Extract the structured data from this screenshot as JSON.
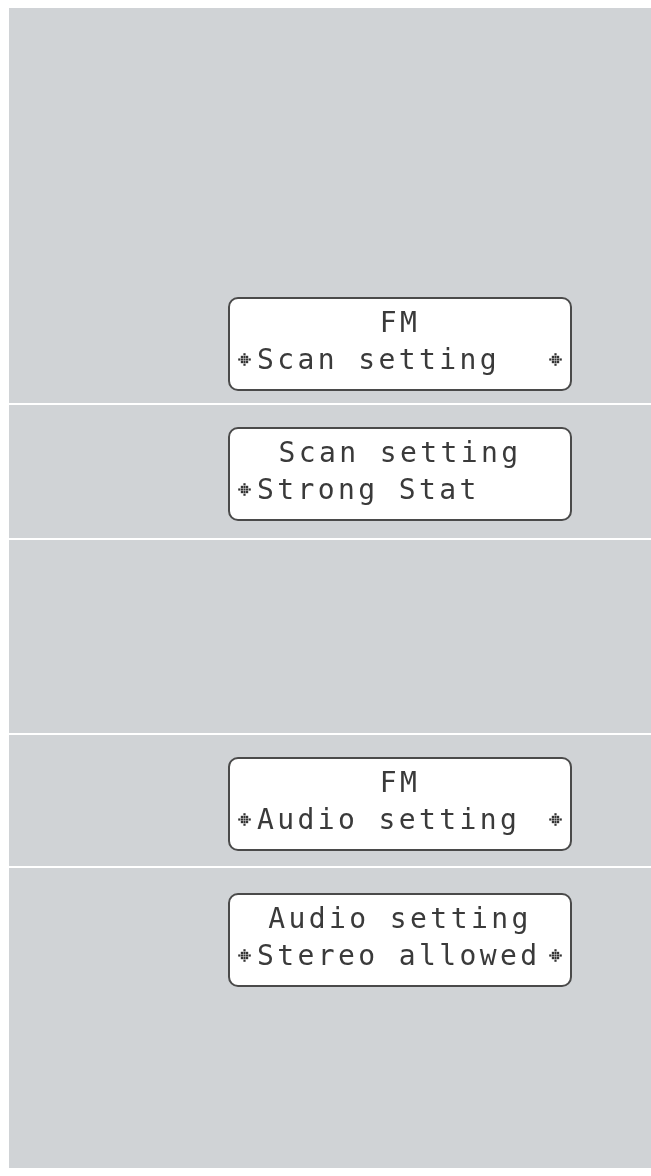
{
  "panels": [
    {
      "kind": "display",
      "lines": [
        {
          "text": "FM",
          "marker_left": false,
          "marker_right": false
        },
        {
          "text": "Scan setting",
          "marker_left": true,
          "marker_right": true
        }
      ]
    },
    {
      "kind": "display",
      "lines": [
        {
          "text": "Scan setting",
          "marker_left": false,
          "marker_right": false
        },
        {
          "text": "Strong Stat",
          "marker_left": true,
          "marker_right": false
        }
      ]
    },
    {
      "kind": "blank"
    },
    {
      "kind": "display",
      "lines": [
        {
          "text": "FM",
          "marker_left": false,
          "marker_right": false
        },
        {
          "text": "Audio setting",
          "marker_left": true,
          "marker_right": true
        }
      ]
    },
    {
      "kind": "display",
      "lines": [
        {
          "text": "Audio setting",
          "marker_left": false,
          "marker_right": false
        },
        {
          "text": "Stereo allowed",
          "marker_left": true,
          "marker_right": true
        }
      ]
    }
  ]
}
